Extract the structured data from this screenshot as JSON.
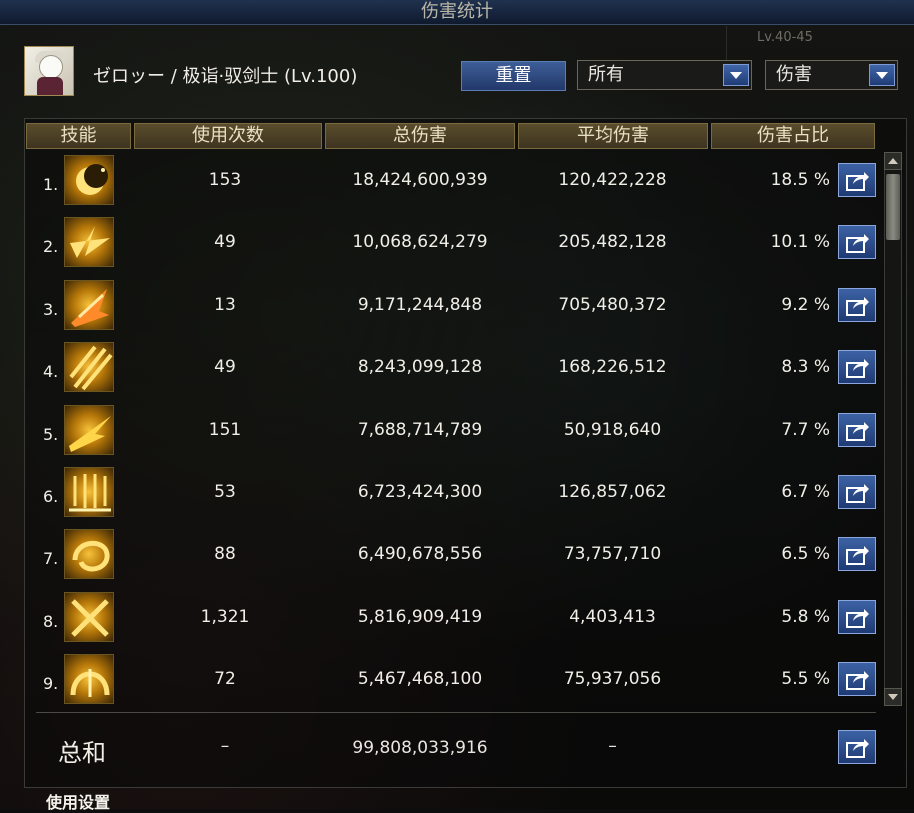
{
  "window": {
    "title": "伤害统计"
  },
  "background": {
    "level_text": "Lv.40-45"
  },
  "player": {
    "name": "ゼロッー / 极诣·驭剑士 (Lv.100)"
  },
  "controls": {
    "reset_label": "重置",
    "filter1_value": "所有",
    "filter2_value": "伤害"
  },
  "columns": [
    "技能",
    "使用次数",
    "总伤害",
    "平均伤害",
    "伤害占比"
  ],
  "rows": [
    {
      "index": "1.",
      "icon": "crescent-moon-icon",
      "uses": "153",
      "total": "18,424,600,939",
      "avg": "120,422,228",
      "pct": "18.5 %"
    },
    {
      "index": "2.",
      "icon": "burst-slash-icon",
      "uses": "49",
      "total": "10,068,624,279",
      "avg": "205,482,128",
      "pct": "10.1 %"
    },
    {
      "index": "3.",
      "icon": "flame-dash-icon",
      "uses": "13",
      "total": "9,171,244,848",
      "avg": "705,480,372",
      "pct": "9.2 %"
    },
    {
      "index": "4.",
      "icon": "triple-slash-icon",
      "uses": "49",
      "total": "8,243,099,128",
      "avg": "168,226,512",
      "pct": "8.3 %"
    },
    {
      "index": "5.",
      "icon": "thrust-icon",
      "uses": "151",
      "total": "7,688,714,789",
      "avg": "50,918,640",
      "pct": "7.7 %"
    },
    {
      "index": "6.",
      "icon": "sword-rain-icon",
      "uses": "53",
      "total": "6,723,424,300",
      "avg": "126,857,062",
      "pct": "6.7 %"
    },
    {
      "index": "7.",
      "icon": "spin-slash-icon",
      "uses": "88",
      "total": "6,490,678,556",
      "avg": "73,757,710",
      "pct": "6.5 %"
    },
    {
      "index": "8.",
      "icon": "cross-blade-icon",
      "uses": "1,321",
      "total": "5,816,909,419",
      "avg": "4,403,413",
      "pct": "5.8 %"
    },
    {
      "index": "9.",
      "icon": "arch-blade-icon",
      "uses": "72",
      "total": "5,467,468,100",
      "avg": "75,937,056",
      "pct": "5.5 %"
    }
  ],
  "totals": {
    "label": "总和",
    "uses": "–",
    "total": "99,808,033,916",
    "avg": "–"
  },
  "footer": {
    "settings_label": "使用设置"
  },
  "colors": {
    "accent": "#2a4a8a",
    "header_gold": "#5a4d2c",
    "icon_gold": "#f7c23a"
  }
}
